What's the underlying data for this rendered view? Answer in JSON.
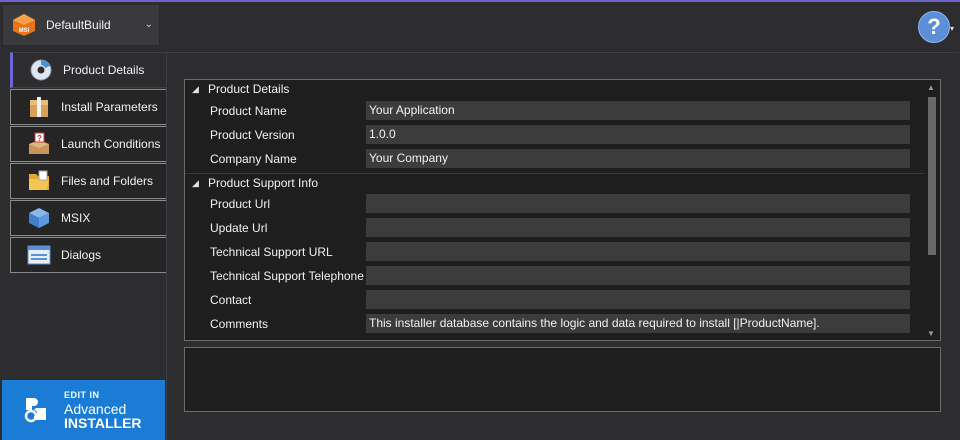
{
  "build": {
    "name": "DefaultBuild",
    "icon_text": "MSI"
  },
  "help": {
    "label": "?"
  },
  "nav": [
    {
      "label": "Product Details",
      "icon": "cd-icon"
    },
    {
      "label": "Install Parameters",
      "icon": "package-icon"
    },
    {
      "label": "Launch Conditions",
      "icon": "box-question-icon"
    },
    {
      "label": "Files and Folders",
      "icon": "folder-icon"
    },
    {
      "label": "MSIX",
      "icon": "cube-icon"
    },
    {
      "label": "Dialogs",
      "icon": "dialog-icon"
    }
  ],
  "promo": {
    "line1": "EDIT IN",
    "line2": "Advanced",
    "line3": "INSTALLER"
  },
  "grid": {
    "categories": [
      {
        "title": "Product Details",
        "rows": [
          {
            "name": "Product Name",
            "value": "Your Application"
          },
          {
            "name": "Product Version",
            "value": "1.0.0"
          },
          {
            "name": "Company Name",
            "value": "Your Company"
          }
        ]
      },
      {
        "title": "Product Support Info",
        "rows": [
          {
            "name": "Product Url",
            "value": ""
          },
          {
            "name": "Update Url",
            "value": ""
          },
          {
            "name": "Technical Support URL",
            "value": ""
          },
          {
            "name": "Technical Support Telephone",
            "value": ""
          },
          {
            "name": "Contact",
            "value": ""
          },
          {
            "name": "Comments",
            "value": "This installer database contains the logic and data required to install [|ProductName]."
          }
        ]
      }
    ]
  },
  "colors": {
    "accent": "#6d67d6",
    "promo": "#1a7cd4",
    "help": "#5b8fd8"
  }
}
